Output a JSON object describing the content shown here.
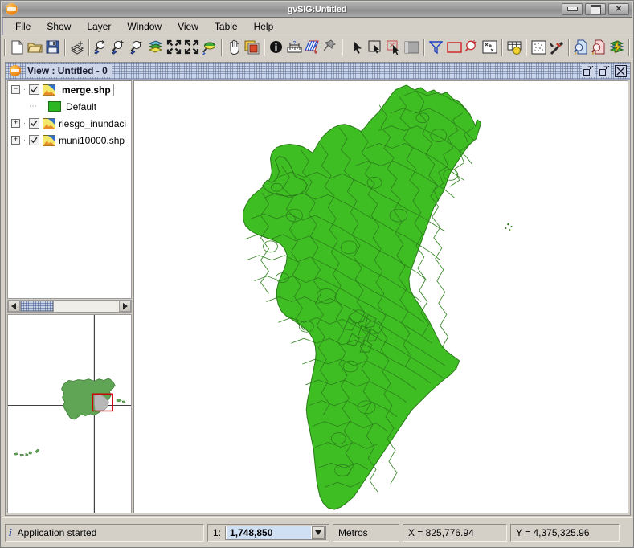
{
  "window": {
    "title": "gvSIG:Untitled",
    "app_icon": "gvsig-logo-icon",
    "buttons": {
      "minimize": "minimize-button",
      "maximize": "maximize-button",
      "close_label": "✕"
    }
  },
  "menubar": {
    "items": [
      {
        "label": "File"
      },
      {
        "label": "Show"
      },
      {
        "label": "Layer"
      },
      {
        "label": "Window"
      },
      {
        "label": "View"
      },
      {
        "label": "Table"
      },
      {
        "label": "Help"
      }
    ]
  },
  "toolbar": {
    "groups": [
      {
        "buttons": [
          {
            "name": "new-project-icon",
            "tooltip": "New"
          },
          {
            "name": "open-project-icon",
            "tooltip": "Open"
          },
          {
            "name": "save-project-icon",
            "tooltip": "Save"
          }
        ]
      },
      {
        "buttons": [
          {
            "name": "add-layer-icon",
            "tooltip": "Add layer"
          }
        ]
      },
      {
        "buttons": [
          {
            "name": "zoom-in-rect-icon",
            "tooltip": "Zoom in by rectangle"
          },
          {
            "name": "zoom-in-icon",
            "tooltip": "Zoom in"
          },
          {
            "name": "zoom-out-icon",
            "tooltip": "Zoom out"
          },
          {
            "name": "zoom-full-extent-icon",
            "tooltip": "Full extent"
          },
          {
            "name": "zoom-to-selection-in-icon",
            "tooltip": "Zoom to selection"
          },
          {
            "name": "zoom-previous-icon",
            "tooltip": "Previous zoom"
          },
          {
            "name": "zoom-layer-icon",
            "tooltip": "Zoom to layer"
          }
        ]
      },
      {
        "buttons": [
          {
            "name": "pan-hand-icon",
            "tooltip": "Pan"
          },
          {
            "name": "locator-setup-icon",
            "tooltip": "Locator setup"
          }
        ]
      },
      {
        "buttons": [
          {
            "name": "info-icon",
            "tooltip": "Information"
          },
          {
            "name": "measure-distance-icon",
            "tooltip": "Measure distance"
          },
          {
            "name": "measure-area-icon",
            "tooltip": "Measure area"
          },
          {
            "name": "pin-annotation-icon",
            "tooltip": "Annotation"
          }
        ]
      },
      {
        "buttons": [
          {
            "name": "select-pointer-icon",
            "tooltip": "Select pointer"
          },
          {
            "name": "select-by-point-icon",
            "tooltip": "Select by point"
          },
          {
            "name": "select-by-polygon-icon",
            "tooltip": "Select by polygon"
          },
          {
            "name": "clear-selection-icon",
            "tooltip": "Clear selection"
          }
        ]
      },
      {
        "buttons": [
          {
            "name": "filter-icon",
            "tooltip": "Filter"
          },
          {
            "name": "select-by-rectangle-icon",
            "tooltip": "Select by rectangle"
          },
          {
            "name": "select-by-attributes-icon",
            "tooltip": "Select by attributes"
          },
          {
            "name": "add-point-icon",
            "tooltip": "Add point"
          }
        ]
      },
      {
        "buttons": [
          {
            "name": "attribute-table-icon",
            "tooltip": "Attribute table"
          }
        ]
      },
      {
        "buttons": [
          {
            "name": "statistics-icon",
            "tooltip": "Statistics"
          },
          {
            "name": "geoprocessing-tools-icon",
            "tooltip": "Geoprocessing tools"
          }
        ]
      },
      {
        "buttons": [
          {
            "name": "search-blue-doc-icon",
            "tooltip": "Search"
          },
          {
            "name": "search-red-doc-icon",
            "tooltip": "Search by layer"
          },
          {
            "name": "layer-properties-icon",
            "tooltip": "Layer properties"
          }
        ]
      }
    ]
  },
  "view_window": {
    "title": "View : Untitled  -  0",
    "icon": "gvsig-view-icon",
    "restore_button": "restore-button",
    "maximize_button": "maximize-button",
    "close_button": "close-button"
  },
  "toc": {
    "layers": [
      {
        "name": "merge.shp",
        "checked": true,
        "expanded": true,
        "selected": true,
        "expander_glyph": "−",
        "symbology": [
          {
            "label": "Default",
            "color": "#2cb622"
          }
        ]
      },
      {
        "name": "riesgo_inundaci",
        "checked": true,
        "expanded": false,
        "selected": false,
        "expander_glyph": "+",
        "symbology": []
      },
      {
        "name": "muni10000.shp",
        "checked": true,
        "expanded": false,
        "selected": false,
        "expander_glyph": "+",
        "symbology": []
      }
    ],
    "hscroll": {
      "left_arrow": "◀",
      "right_arrow": "▶"
    }
  },
  "map": {
    "fill_color": "#3fbe24",
    "stroke_color": "#2c7f1b",
    "background": "#ffffff",
    "region": "Comunitat Valenciana municipalities"
  },
  "overview": {
    "fill_color": "#5fa555",
    "highlight_fill": "#b7b7b7",
    "extent_box_color": "#cc0000",
    "crosshair_color": "#000000"
  },
  "statusbar": {
    "message": "Application started",
    "message_icon": "info-icon",
    "scale_prefix": "1:",
    "scale_value": "1,748,850",
    "scale_dropdown_glyph": "▼",
    "units": "Metros",
    "coord_x": "X = 825,776.94",
    "coord_y": "Y = 4,375,325.96"
  }
}
